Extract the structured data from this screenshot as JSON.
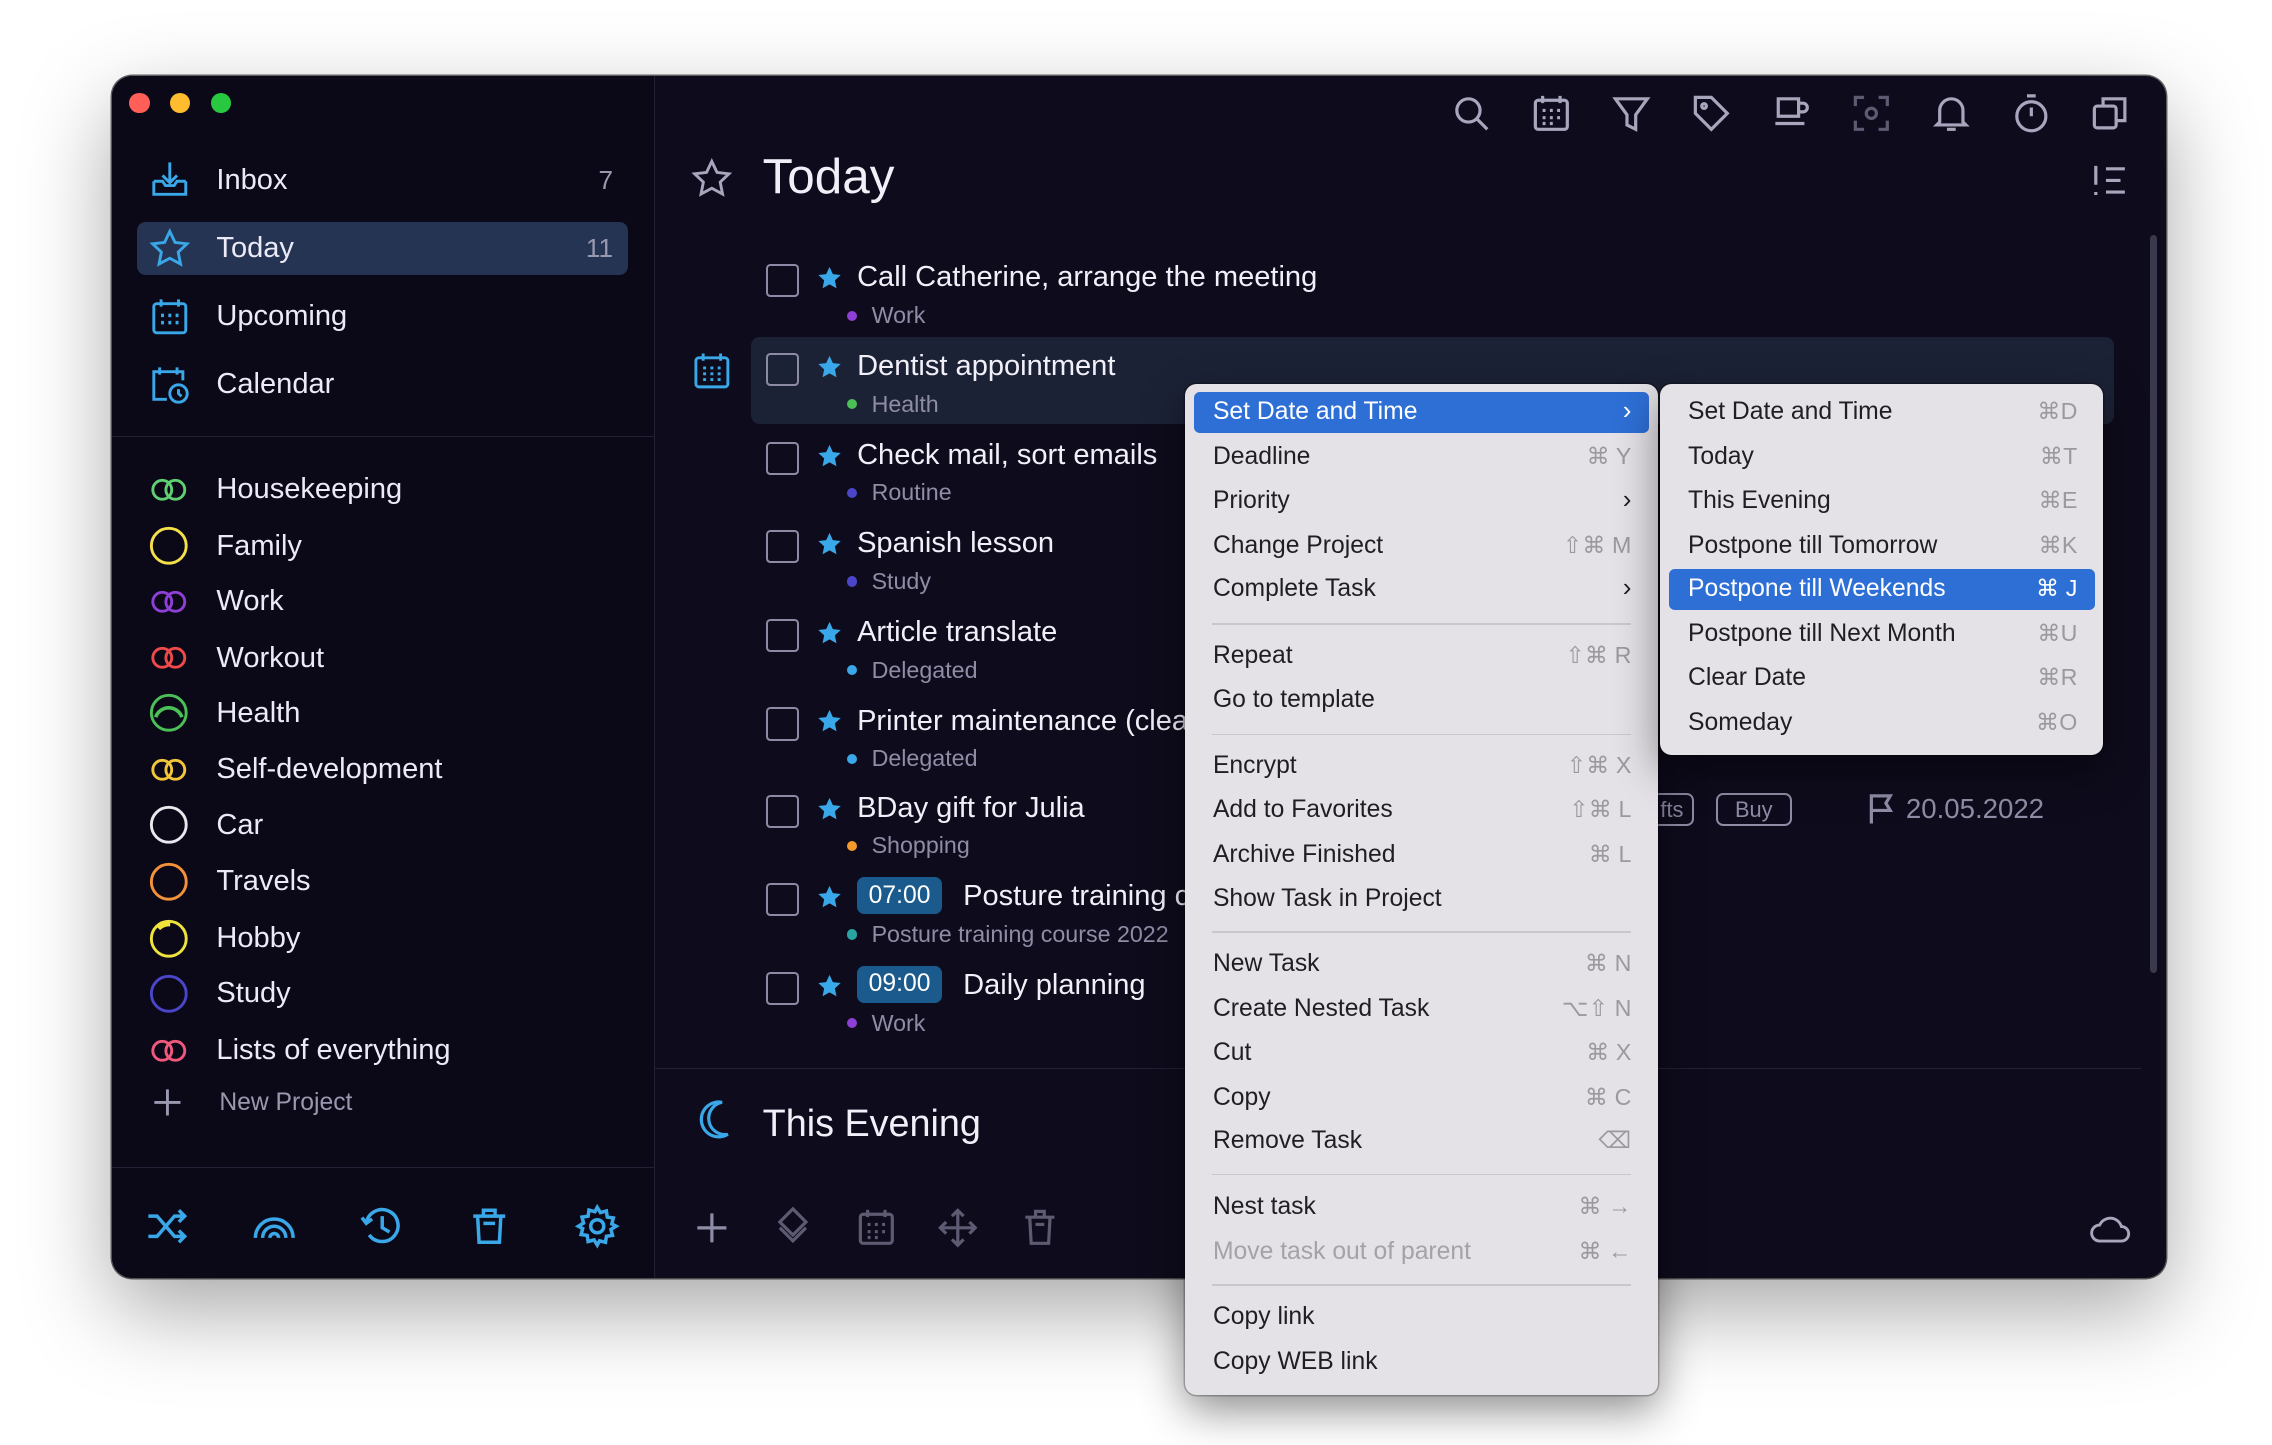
{
  "sidebar": {
    "nav": [
      {
        "label": "Inbox",
        "count": "7",
        "icon": "inbox-icon"
      },
      {
        "label": "Today",
        "count": "11",
        "icon": "star-icon"
      },
      {
        "label": "Upcoming",
        "count": "",
        "icon": "calendar-grid-icon"
      },
      {
        "label": "Calendar",
        "count": "",
        "icon": "calendar-clock-icon"
      }
    ],
    "projects": [
      {
        "label": "Housekeeping",
        "color": "#5fcf71"
      },
      {
        "label": "Family",
        "color": "#f4e04a"
      },
      {
        "label": "Work",
        "color": "#8e3fd6"
      },
      {
        "label": "Workout",
        "color": "#ef4a4a"
      },
      {
        "label": "Health",
        "color": "#4bc057"
      },
      {
        "label": "Self-development",
        "color": "#f2c53a"
      },
      {
        "label": "Car",
        "color": "#e8e8ee"
      },
      {
        "label": "Travels",
        "color": "#f3923a"
      },
      {
        "label": "Hobby",
        "color": "#f0e43c"
      },
      {
        "label": "Study",
        "color": "#4b46c9"
      },
      {
        "label": "Lists of everything",
        "color": "#f0587c"
      }
    ],
    "new_project": "New Project"
  },
  "main": {
    "title": "Today",
    "evening_title": "This Evening",
    "tasks": [
      {
        "title": "Call Catherine, arrange the meeting",
        "project": "Work",
        "dot": "#8e3fd6",
        "time": ""
      },
      {
        "title": "Dentist appointment",
        "project": "Health",
        "dot": "#4bc057",
        "time": ""
      },
      {
        "title": "Check mail, sort emails",
        "project": "Routine",
        "dot": "#4b46c9",
        "time": ""
      },
      {
        "title": "Spanish lesson",
        "project": "Study",
        "dot": "#4b46c9",
        "time": ""
      },
      {
        "title": "Article translate",
        "project": "Delegated",
        "dot": "#3aa8e8",
        "time": ""
      },
      {
        "title": "Printer maintenance (clea",
        "project": "Delegated",
        "dot": "#3aa8e8",
        "time": ""
      },
      {
        "title": "BDay gift for Julia",
        "project": "Shopping",
        "dot": "#f39a2a",
        "time": ""
      },
      {
        "title": "Posture training c",
        "project": "Posture training course 2022",
        "dot": "#2aa3a3",
        "time": "07:00"
      },
      {
        "title": "Daily planning",
        "project": "Work",
        "dot": "#8e3fd6",
        "time": "09:00"
      }
    ],
    "tag_partial": "fts",
    "tag_buy": "Buy",
    "deadline": "20.05.2022"
  },
  "context_menu": {
    "items": [
      {
        "label": "Set Date and Time",
        "shortcut": "",
        "submenu": true
      },
      {
        "label": "Deadline",
        "shortcut": "⌘ Y"
      },
      {
        "label": "Priority",
        "shortcut": "",
        "submenu": true
      },
      {
        "label": "Change Project",
        "shortcut": "⇧⌘ M"
      },
      {
        "label": "Complete Task",
        "shortcut": "",
        "submenu": true
      },
      {
        "label": "Repeat",
        "shortcut": "⇧⌘ R"
      },
      {
        "label": "Go to template",
        "shortcut": ""
      },
      {
        "label": "Encrypt",
        "shortcut": "⇧⌘ X"
      },
      {
        "label": "Add to Favorites",
        "shortcut": "⇧⌘ L"
      },
      {
        "label": "Archive Finished",
        "shortcut": "⌘ L"
      },
      {
        "label": "Show Task in Project",
        "shortcut": ""
      },
      {
        "label": "New Task",
        "shortcut": "⌘ N"
      },
      {
        "label": "Create Nested Task",
        "shortcut": "⌥⇧ N"
      },
      {
        "label": "Cut",
        "shortcut": "⌘ X"
      },
      {
        "label": "Copy",
        "shortcut": "⌘ C"
      },
      {
        "label": "Remove Task",
        "shortcut": "⌫"
      },
      {
        "label": "Nest task",
        "shortcut": "⌘ →"
      },
      {
        "label": "Move task out of parent",
        "shortcut": "⌘ ←"
      },
      {
        "label": "Copy link",
        "shortcut": ""
      },
      {
        "label": "Copy WEB link",
        "shortcut": ""
      }
    ]
  },
  "submenu": {
    "items": [
      {
        "label": "Set Date and Time",
        "shortcut": "⌘D"
      },
      {
        "label": "Today",
        "shortcut": "⌘T"
      },
      {
        "label": "This Evening",
        "shortcut": "⌘E"
      },
      {
        "label": "Postpone till Tomorrow",
        "shortcut": "⌘K"
      },
      {
        "label": "Postpone till Weekends",
        "shortcut": "⌘ J"
      },
      {
        "label": "Postpone till Next Month",
        "shortcut": "⌘U"
      },
      {
        "label": "Clear Date",
        "shortcut": "⌘R"
      },
      {
        "label": "Someday",
        "shortcut": "⌘O"
      }
    ]
  },
  "colors": {
    "accent": "#3aa8e8",
    "selection": "#2e6fd6"
  }
}
